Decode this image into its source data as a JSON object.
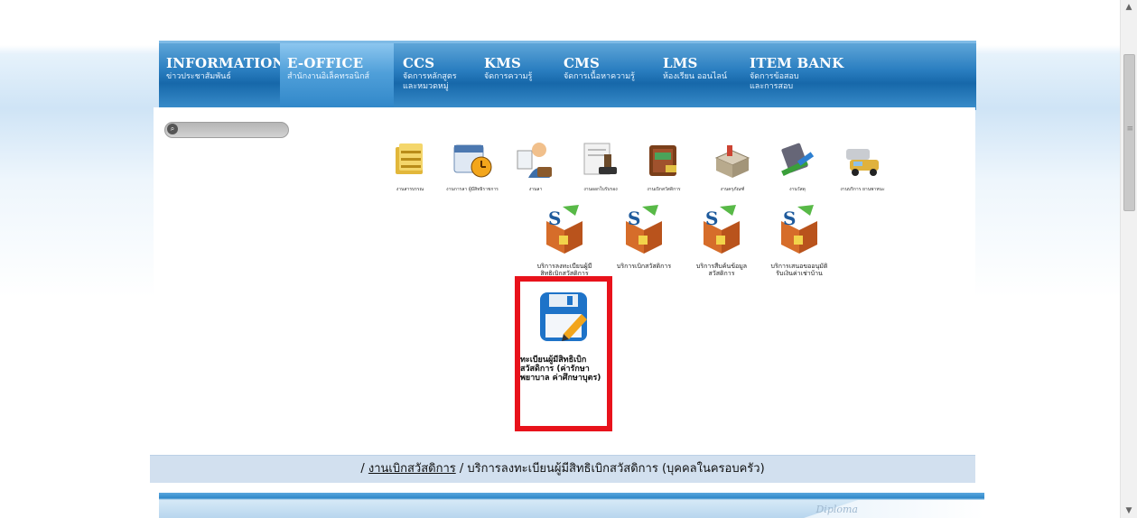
{
  "nav": {
    "items": [
      {
        "title": "INFORMATION",
        "sub": "ข่าวประชาสัมพันธ์"
      },
      {
        "title": "E-OFFICE",
        "sub": "สำนักงานอิเล็คทรอนิกส์"
      },
      {
        "title": "CCS",
        "sub": "จัดการหลักสูตร และหมวดหมู่"
      },
      {
        "title": "KMS",
        "sub": "จัดการความรู้"
      },
      {
        "title": "CMS",
        "sub": "จัดการเนื้อหาความรู้"
      },
      {
        "title": "LMS",
        "sub": "ห้องเรียน ออนไลน์"
      },
      {
        "title": "ITEM BANK",
        "sub": "จัดการข้อสอบ และการสอบ"
      }
    ],
    "active": "E-OFFICE"
  },
  "apps": [
    {
      "label": "งานสารบรรณ",
      "icon": "folder-files-icon"
    },
    {
      "label": "งานการลา ผู้มีสิทธิราชการ",
      "icon": "calendar-clock-icon"
    },
    {
      "label": "งานลา",
      "icon": "person-briefcase-icon"
    },
    {
      "label": "งานออกใบรับรอง",
      "icon": "stamp-document-icon"
    },
    {
      "label": "งานเบิกสวัสดิการ",
      "icon": "wallet-icon"
    },
    {
      "label": "งานครุภัณฑ์",
      "icon": "toolbox-icon"
    },
    {
      "label": "งานวัสดุ",
      "icon": "stationery-icon"
    },
    {
      "label": "งานบริการ ยานพาหนะ",
      "icon": "vehicle-icon"
    }
  ],
  "services": [
    {
      "label": "บริการลงทะเบียนผู้มีสิทธิเบิกสวัสดิการ (บุคคลในครอบครัว)",
      "icon": "service-box-icon"
    },
    {
      "label": "บริการเบิกสวัสดิการ",
      "icon": "service-box-icon"
    },
    {
      "label": "บริการสืบค้นข้อมูลสวัสดิการ",
      "icon": "service-box-icon"
    },
    {
      "label": "บริการเสนอขออนุมัติรับเงินค่าเช่าบ้าน",
      "icon": "service-box-icon"
    }
  ],
  "highlight": {
    "label": "ทะเบียนผู้มีสิทธิเบิกสวัสดิการ (ค่ารักษาพยาบาล ค่าศึกษาบุตร)",
    "icon": "save-edit-icon",
    "border_color": "#e8121b"
  },
  "breadcrumb": {
    "sep": "/",
    "link": "งานเบิกสวัสดิการ",
    "current": "บริการลงทะเบียนผู้มีสิทธิเบิกสวัสดิการ (บุคคลในครอบครัว)"
  },
  "footer": {
    "text": "Diploma"
  },
  "colors": {
    "nav_dark": "#1768aa",
    "nav_light": "#5ea5d8",
    "crumb_bg": "#d2e0ef"
  }
}
